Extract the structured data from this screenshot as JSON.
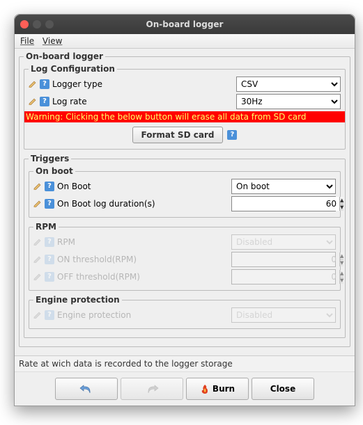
{
  "window": {
    "title": "On-board logger"
  },
  "menubar": {
    "file": "File",
    "view": "View"
  },
  "logger": {
    "title": "On-board logger",
    "config": {
      "title": "Log Configuration",
      "type_label": "Logger type",
      "type_value": "CSV",
      "rate_label": "Log rate",
      "rate_value": "30Hz",
      "warning": "Warning: Clicking the below button will erase all data from SD card",
      "format_btn": "Format SD card"
    },
    "triggers": {
      "title": "Triggers",
      "onboot": {
        "title": "On boot",
        "label": "On Boot",
        "value": "On boot",
        "dur_label": "On Boot log duration(s)",
        "dur_value": "60"
      },
      "rpm": {
        "title": "RPM",
        "label": "RPM",
        "value": "Disabled",
        "on_label": "ON threshold(RPM)",
        "on_value": "0",
        "off_label": "OFF threshold(RPM)",
        "off_value": "0"
      },
      "engine": {
        "title": "Engine protection",
        "label": "Engine protection",
        "value": "Disabled"
      }
    }
  },
  "status": "Rate at wich data is recorded to the logger storage",
  "buttons": {
    "burn": "Burn",
    "close": "Close"
  }
}
